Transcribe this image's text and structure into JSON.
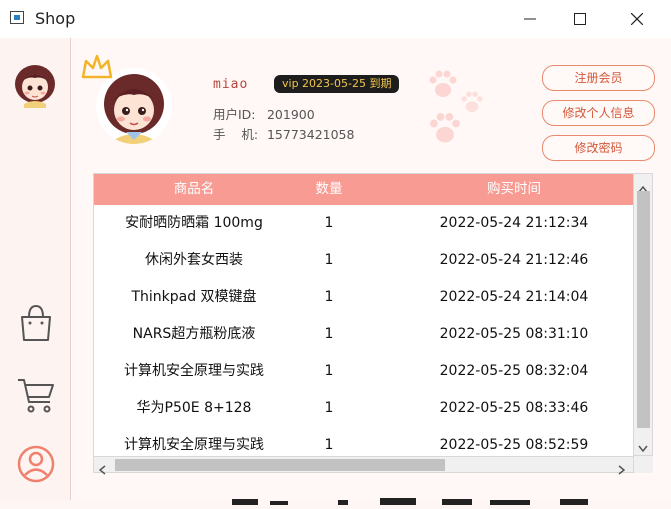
{
  "window": {
    "title": "Shop"
  },
  "user": {
    "name": "miao",
    "vip_badge": "vip 2023-05-25 到期",
    "id_label": "用户ID:",
    "id_value": "201900",
    "phone_label": "手    机:",
    "phone_value": "15773421058"
  },
  "actions": {
    "register": "注册会员",
    "edit_info": "修改个人信息",
    "change_password": "修改密码"
  },
  "sidebar": {
    "items": [
      {
        "name": "shopping-bag-icon"
      },
      {
        "name": "cart-icon"
      },
      {
        "name": "user-icon"
      }
    ]
  },
  "orders": {
    "columns": [
      "商品名",
      "数量",
      "购买时间"
    ],
    "rows": [
      {
        "name": "安耐晒防晒霜 100mg",
        "qty": "1",
        "time": "2022-05-24 21:12:34"
      },
      {
        "name": "休闲外套女西装",
        "qty": "1",
        "time": "2022-05-24 21:12:46"
      },
      {
        "name": "Thinkpad 双模键盘",
        "qty": "1",
        "time": "2022-05-24 21:14:04"
      },
      {
        "name": "NARS超方瓶粉底液",
        "qty": "1",
        "time": "2022-05-25 08:31:10"
      },
      {
        "name": "计算机安全原理与实践",
        "qty": "1",
        "time": "2022-05-25 08:32:04"
      },
      {
        "name": "华为P50E 8+128",
        "qty": "1",
        "time": "2022-05-25 08:33:46"
      },
      {
        "name": "计算机安全原理与实践",
        "qty": "1",
        "time": "2022-05-25 08:52:59"
      }
    ]
  },
  "colors": {
    "accent": "#f79b93",
    "button_border": "#e98a6d",
    "vip_bg": "#1d1d1d",
    "vip_text": "#f2c64a"
  }
}
